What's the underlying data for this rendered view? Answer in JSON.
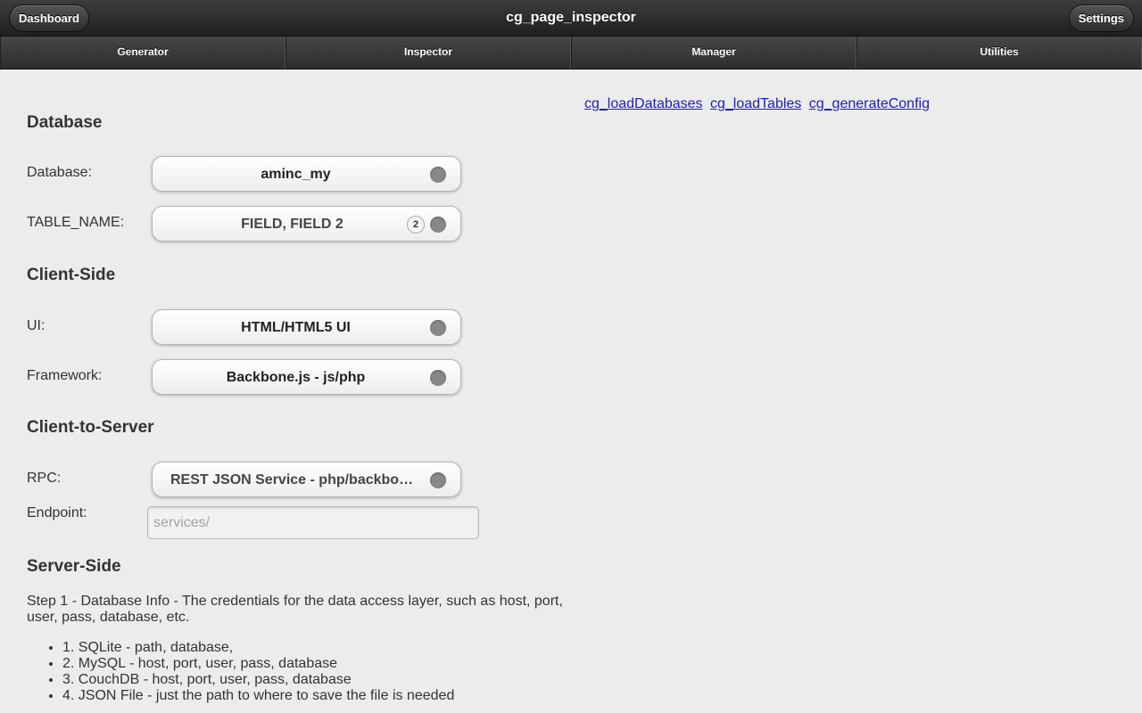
{
  "header": {
    "title": "cg_page_inspector",
    "left_button": "Dashboard",
    "right_button": "Settings"
  },
  "nav": {
    "tabs": [
      {
        "label": "Generator"
      },
      {
        "label": "Inspector"
      },
      {
        "label": "Manager"
      },
      {
        "label": "Utilities"
      }
    ]
  },
  "links": [
    {
      "label": "cg_loadDatabases"
    },
    {
      "label": "cg_loadTables"
    },
    {
      "label": "cg_generateConfig"
    }
  ],
  "form": {
    "sections": {
      "database": "Database",
      "client_side": "Client-Side",
      "client_to_server": "Client-to-Server",
      "server_side": "Server-Side"
    },
    "database": {
      "label": "Database:",
      "value": "aminc_my"
    },
    "table_name": {
      "label": "TABLE_NAME:",
      "value": "FIELD, FIELD 2",
      "count": "2"
    },
    "ui": {
      "label": "UI:",
      "value": "HTML/HTML5 UI"
    },
    "framework": {
      "label": "Framework:",
      "value": "Backbone.js - js/php"
    },
    "rpc": {
      "label": "RPC:",
      "value": "REST JSON Service - php/backbone.js"
    },
    "endpoint": {
      "label": "Endpoint:",
      "placeholder": "services/"
    }
  },
  "server_side": {
    "description": "Step 1 - Database Info - The credentials for the data access layer, such as host, port, user, pass, database, etc.",
    "steps": [
      "1. SQLite - path, database,",
      "2. MySQL - host, port, user, pass, database",
      "3. CouchDB - host, port, user, pass, database",
      "4. JSON File - just the path to where to save the file is needed"
    ]
  }
}
